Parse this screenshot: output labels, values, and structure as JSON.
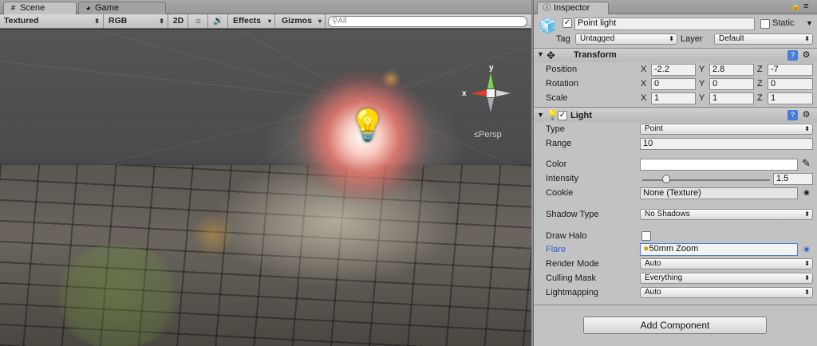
{
  "scene_tabs": {
    "scene": "Scene",
    "game": "Game"
  },
  "scene_toolbar": {
    "draw_mode": "Textured",
    "render_mode": "RGB",
    "mode_2d": "2D",
    "effects": "Effects",
    "gizmos": "Gizmos",
    "search_placeholder": "All"
  },
  "viewport": {
    "axis_y": "y",
    "axis_x": "x",
    "projection": "Persp"
  },
  "inspector": {
    "tab": "Inspector",
    "object_name": "Point light",
    "active": true,
    "static_label": "Static",
    "tag_label": "Tag",
    "tag_value": "Untagged",
    "layer_label": "Layer",
    "layer_value": "Default",
    "transform": {
      "title": "Transform",
      "rows": [
        {
          "label": "Position",
          "x": "-2.2",
          "y": "2.8",
          "z": "-7"
        },
        {
          "label": "Rotation",
          "x": "0",
          "y": "0",
          "z": "0"
        },
        {
          "label": "Scale",
          "x": "1",
          "y": "1",
          "z": "1"
        }
      ],
      "axis_x": "X",
      "axis_y": "Y",
      "axis_z": "Z"
    },
    "light": {
      "title": "Light",
      "type_label": "Type",
      "type_value": "Point",
      "range_label": "Range",
      "range_value": "10",
      "color_label": "Color",
      "color_value": "#ffffff",
      "intensity_label": "Intensity",
      "intensity_value": "1.5",
      "intensity_fraction": 0.19,
      "cookie_label": "Cookie",
      "cookie_value": "None (Texture)",
      "shadow_label": "Shadow Type",
      "shadow_value": "No Shadows",
      "halo_label": "Draw Halo",
      "flare_label": "Flare",
      "flare_value": "50mm Zoom",
      "render_mode_label": "Render Mode",
      "render_mode_value": "Auto",
      "culling_label": "Culling Mask",
      "culling_value": "Everything",
      "lightmapping_label": "Lightmapping",
      "lightmapping_value": "Auto"
    },
    "add_component": "Add Component"
  }
}
